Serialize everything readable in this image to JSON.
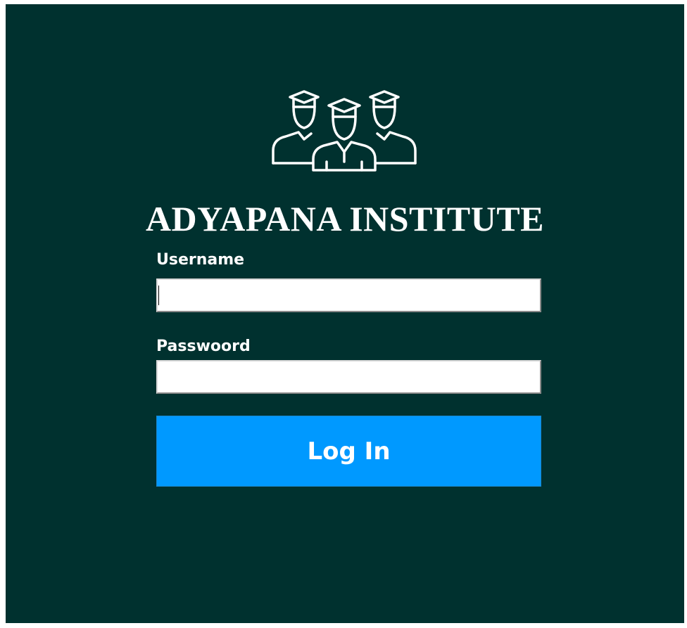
{
  "app": {
    "title": "ADYAPANA INSTITUTE",
    "logo_icon": "graduates-group-icon",
    "background_color": "#00312f"
  },
  "form": {
    "username_label": "Username",
    "username_value": "",
    "password_label": "Passwoord",
    "password_value": "",
    "login_label": "Log In",
    "login_color": "#0099ff"
  }
}
